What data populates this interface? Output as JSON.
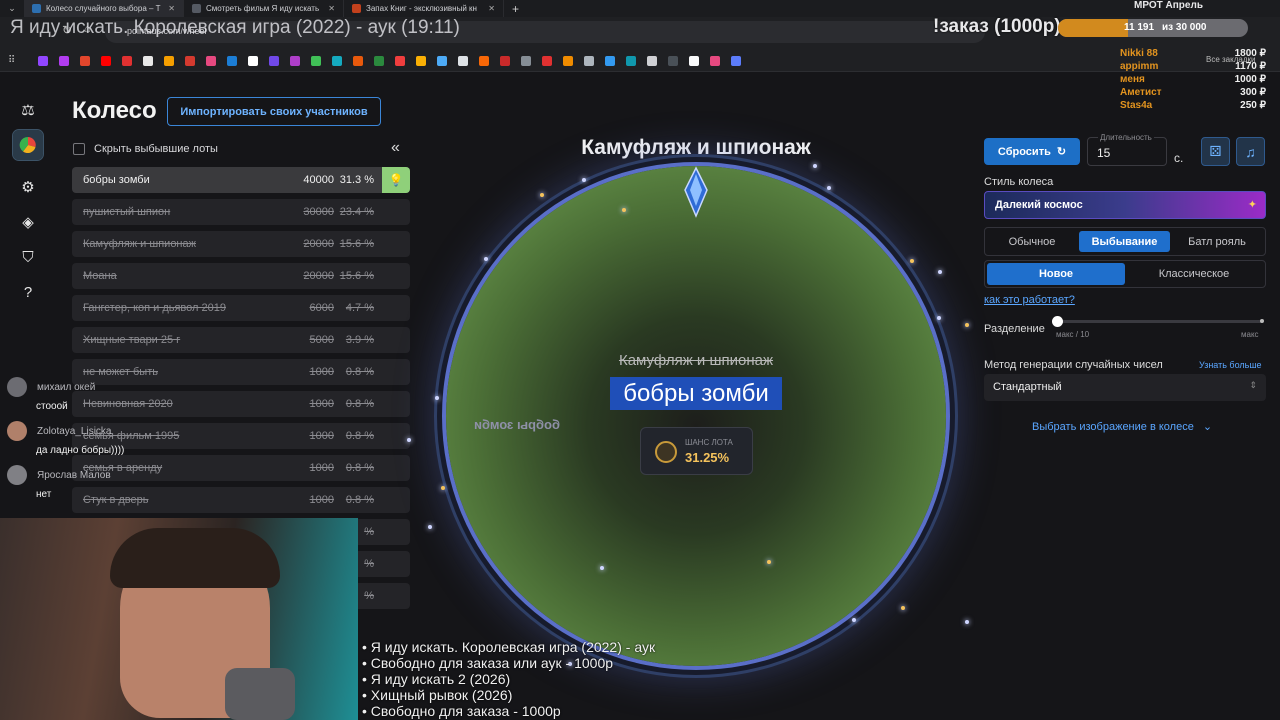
{
  "browser": {
    "tabs": [
      {
        "title": "Колесо случайного выбора – Т",
        "fav": "#2d6fb0"
      },
      {
        "title": "Смотреть фильм Я иду искать",
        "fav": "#555a63"
      },
      {
        "title": "Запах Книг - эксклюзивный кн",
        "fav": "#c2411d"
      }
    ],
    "new_tab": "+",
    "url": "pointauc.com/wheel",
    "bookmarks_tail": "Все закладки"
  },
  "overlay": {
    "stream_title": "Я иду искать. Королевская игра (2022) - аук (19:11)",
    "order_label": "!заказ (1000р)",
    "progress_current": "11 191",
    "progress_total": "из 30 000",
    "progress_fraction": 0.37,
    "mrot_label": "МРОТ Апрель",
    "donors": [
      {
        "name": "Nikki 88",
        "amount": "1800 ₽"
      },
      {
        "name": "appimm",
        "amount": "1170 ₽"
      },
      {
        "name": "меня",
        "amount": "1000 ₽"
      },
      {
        "name": "Аметист",
        "amount": "300 ₽"
      },
      {
        "name": "Stas4a",
        "amount": "250 ₽"
      }
    ],
    "chat": [
      {
        "user": "михаил окей",
        "text": "стооой",
        "avatar": "#6c6c72"
      },
      {
        "user": "Zolotaya_Lisicka",
        "text": "да ладно бобры))))",
        "avatar": "#b0806a"
      },
      {
        "user": "Ярослав Малов",
        "text": "нет",
        "avatar": "#808085"
      }
    ],
    "queue": [
      "• Я иду искать. Королевская игра (2022) - аук",
      "• Свободно для заказа или аук - 1000р",
      "• Я иду искать 2 (2026)",
      "• Хищный рывок (2026)",
      "• Свободно для заказа - 1000р"
    ]
  },
  "sidebar": {
    "title": "Колесо",
    "import_label": "Импортировать своих участников",
    "hide_label": "Скрыть выбывшие лоты",
    "collapse_icon": "«",
    "lots": [
      {
        "name": "бобры зомби",
        "amount": "40000",
        "percent": "31.3 %"
      },
      {
        "name": "пушистый шпион",
        "amount": "30000",
        "percent": "23.4 %"
      },
      {
        "name": "Камуфляж и шпионаж",
        "amount": "20000",
        "percent": "15.6 %"
      },
      {
        "name": "Моана",
        "amount": "20000",
        "percent": "15.6 %"
      },
      {
        "name": "Гангстер, коп и дьявол 2019",
        "amount": "6000",
        "percent": "4.7 %"
      },
      {
        "name": "Хищные твари 25 г",
        "amount": "5000",
        "percent": "3.9 %"
      },
      {
        "name": "не может быть",
        "amount": "1000",
        "percent": "0.8 %"
      },
      {
        "name": "Невиновная 2020",
        "amount": "1000",
        "percent": "0.8 %"
      },
      {
        "name": "семья фильм 1995",
        "amount": "1000",
        "percent": "0.8 %"
      },
      {
        "name": "семья в аренду",
        "amount": "1000",
        "percent": "0.8 %"
      },
      {
        "name": "Стук в дверь",
        "amount": "1000",
        "percent": "0.8 %"
      },
      {
        "name": "",
        "amount": "",
        "percent": "%"
      },
      {
        "name": "",
        "amount": "",
        "percent": "%"
      },
      {
        "name": "",
        "amount": "",
        "percent": "%"
      }
    ]
  },
  "wheel": {
    "current_lot": "Камуфляж и шпионаж",
    "eliminated": "Камуфляж и шпионаж",
    "winner": "бобры зомби",
    "mirrored": "бобры зомби",
    "chance_label": "ШАНС ЛОТА",
    "chance_value": "31.25%"
  },
  "settings": {
    "reset_label": "Сбросить",
    "duration_label": "Длительность",
    "duration_value": "15",
    "duration_unit": "с.",
    "style_label": "Стиль колеса",
    "style_value": "Далекий космос",
    "modes": [
      "Обычное",
      "Выбывание",
      "Батл рояль"
    ],
    "active_mode": 1,
    "variants": [
      "Новое",
      "Классическое"
    ],
    "active_variant": 0,
    "how_link": "как это работает?",
    "split_label": "Разделение",
    "split_min": "макс / 10",
    "split_max": "макс",
    "split_value": 0,
    "rng_label": "Метод генерации случайных чисел",
    "rng_more": "Узнать больше",
    "rng_value": "Стандартный",
    "image_label": "Выбрать изображение в колесе"
  }
}
